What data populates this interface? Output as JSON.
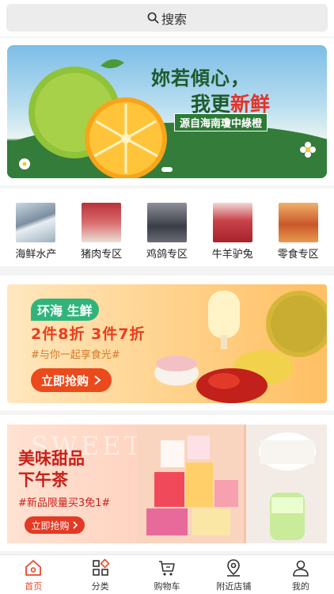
{
  "search": {
    "label": "搜索"
  },
  "banner": {
    "line1": "妳若傾心，",
    "line2_prefix": "我更",
    "line2_highlight": "新鲜",
    "line3": "源自海南瓊中綠橙"
  },
  "categories": [
    {
      "label": "海鲜水产"
    },
    {
      "label": "猪肉专区"
    },
    {
      "label": "鸡鸽专区"
    },
    {
      "label": "牛羊驴兔"
    },
    {
      "label": "零食专区"
    }
  ],
  "promo": {
    "brand": "环海 生鲜",
    "deal": "2件8折  3件7折",
    "tag": "#与你一起享食光#",
    "button": "立即抢购",
    "button_icon": "chevron-right"
  },
  "sweet": {
    "ghost": "SWEET",
    "title_line1": "美味甜品",
    "title_line2": "下午茶",
    "tag": "#新品限量买3免1#",
    "button": "立即抢购",
    "button_icon": "chevron-right"
  },
  "tabs": [
    {
      "label": "首页",
      "icon": "home-icon"
    },
    {
      "label": "分类",
      "icon": "category-icon"
    },
    {
      "label": "购物车",
      "icon": "cart-icon"
    },
    {
      "label": "附近店铺",
      "icon": "location-icon"
    },
    {
      "label": "我的",
      "icon": "user-icon"
    }
  ],
  "colors": {
    "accent": "#e8482b",
    "promo_button": "#ea4a1c",
    "sweet_red": "#c8201a",
    "brand_green": "#2fb57c"
  }
}
